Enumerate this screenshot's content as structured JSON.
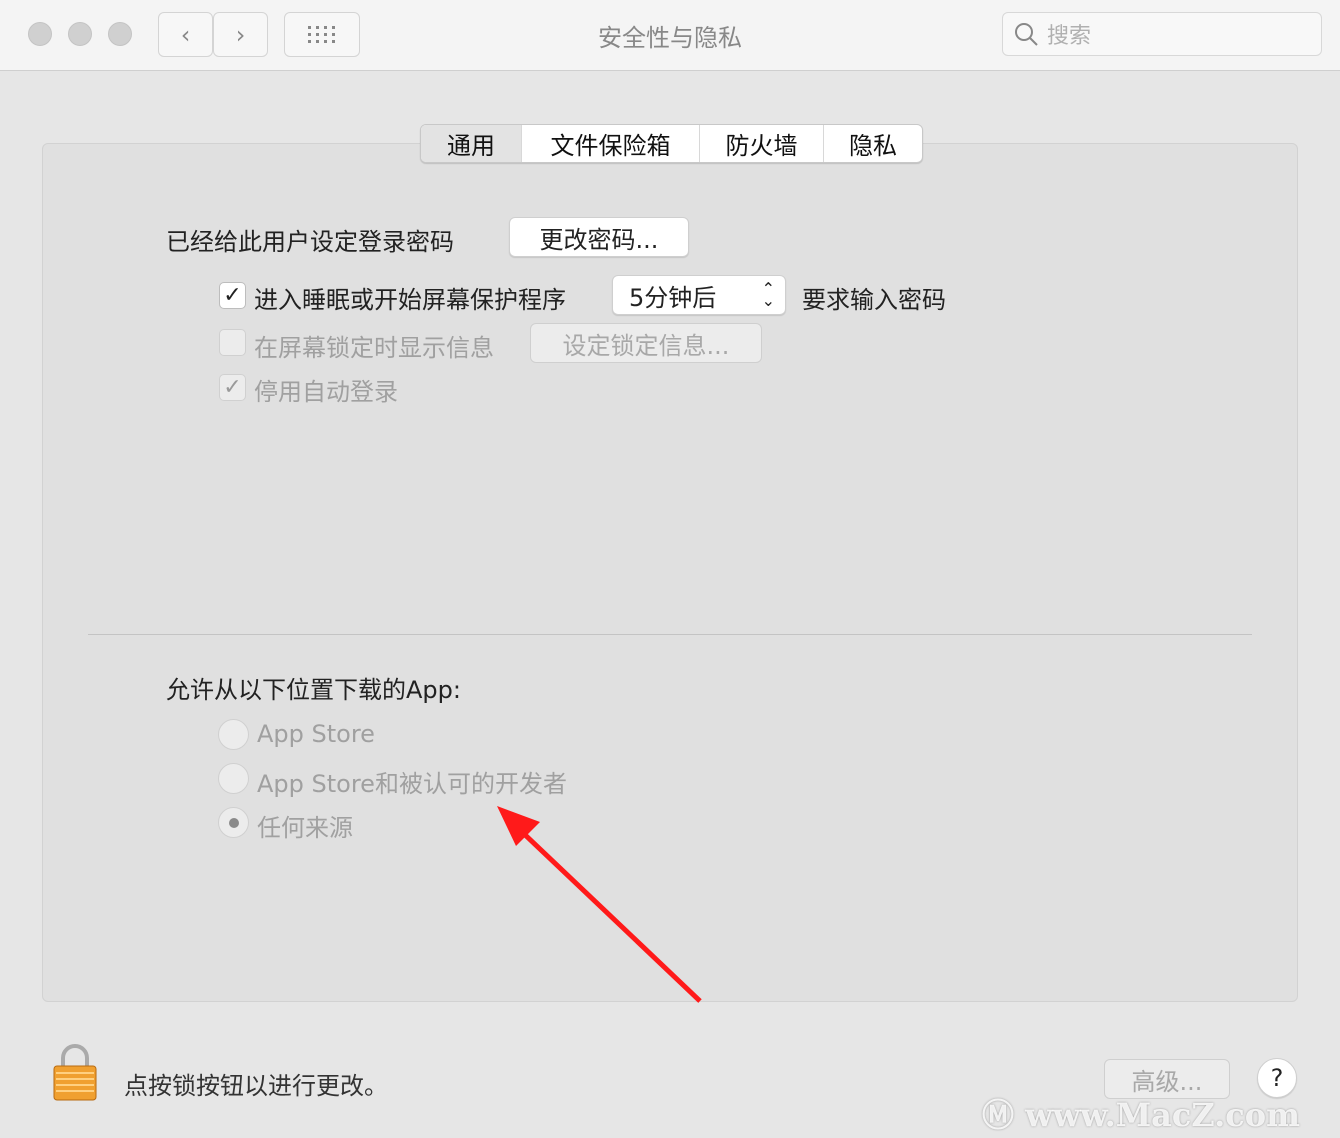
{
  "window": {
    "title": "安全性与隐私",
    "search_placeholder": "搜索"
  },
  "tabs": [
    {
      "label": "通用",
      "selected": true
    },
    {
      "label": "文件保险箱"
    },
    {
      "label": "防火墙"
    },
    {
      "label": "隐私"
    }
  ],
  "general": {
    "password_label": "已经给此用户设定登录密码",
    "change_password_button": "更改密码...",
    "require_password": {
      "checked": true,
      "label": "进入睡眠或开始屏幕保护程序",
      "select_value": "5分钟后",
      "suffix": "要求输入密码"
    },
    "show_message": {
      "checked": false,
      "label": "在屏幕锁定时显示信息",
      "button": "设定锁定信息..."
    },
    "disable_autologin": {
      "checked": true,
      "label": "停用自动登录"
    },
    "allow_apps_label": "允许从以下位置下载的App:",
    "allow_options": [
      {
        "label": "App Store",
        "selected": false
      },
      {
        "label": "App Store和被认可的开发者",
        "selected": false
      },
      {
        "label": "任何来源",
        "selected": true
      }
    ]
  },
  "footer": {
    "lock_text": "点按锁按钮以进行更改。",
    "advanced_button": "高级...",
    "help_button": "?"
  },
  "watermark": "www.MacZ.com",
  "annotation_color": "#ff1a1a"
}
